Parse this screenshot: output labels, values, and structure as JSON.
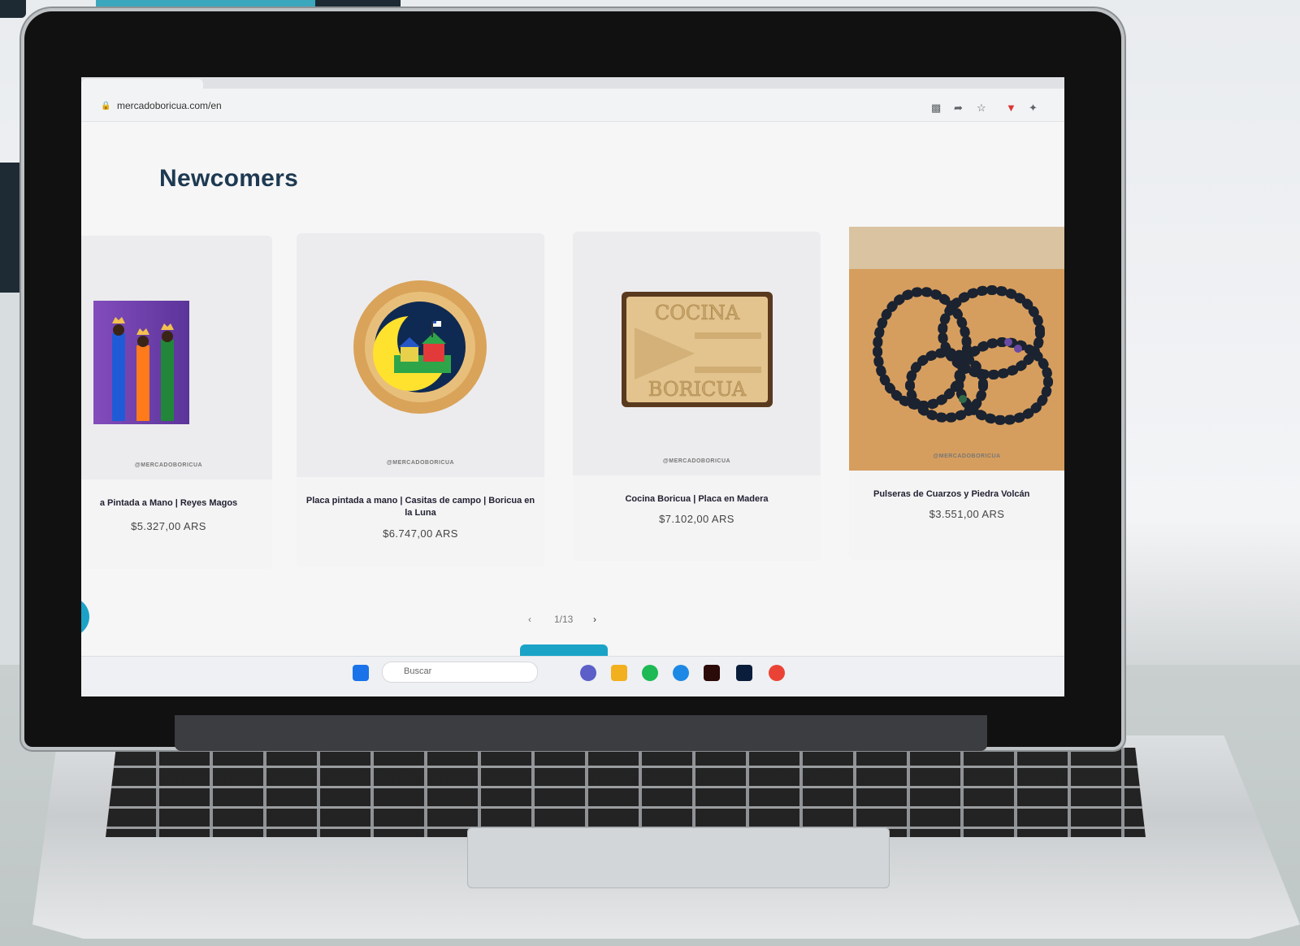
{
  "browser": {
    "url": "mercadoboricua.com/en"
  },
  "page": {
    "title": "Newcomers",
    "watermark": "@MERCADOBORICUA",
    "products": [
      {
        "title": "a Pintada a Mano | Reyes Magos",
        "price": "$5.327,00 ARS"
      },
      {
        "title": "Placa pintada a mano | Casitas de campo | Boricua en la Luna",
        "price": "$6.747,00 ARS"
      },
      {
        "title": "Cocina Boricua | Placa en Madera",
        "price": "$7.102,00 ARS"
      },
      {
        "title": "Pulseras de Cuarzos y Piedra Volcán",
        "price": "$3.551,00 ARS"
      }
    ],
    "pager": {
      "prev": "‹",
      "label": "1/13",
      "next": "›"
    },
    "plaque_text_top": "COCINA",
    "plaque_text_bottom": "BORICUA"
  },
  "taskbar": {
    "search_placeholder": "Buscar"
  },
  "colors": {
    "accent": "#1aa3c7",
    "title": "#1e3a52"
  }
}
